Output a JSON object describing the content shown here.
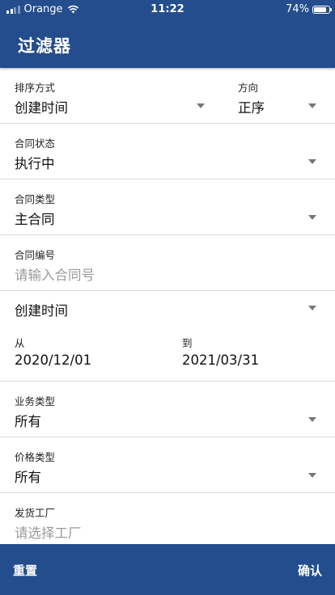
{
  "status_bar": {
    "carrier": "Orange",
    "time": "11:22",
    "battery": "74%"
  },
  "header": {
    "title": "过滤器"
  },
  "sort": {
    "label": "排序方式",
    "value": "创建时间",
    "direction_label": "方向",
    "direction_value": "正序"
  },
  "contract_status": {
    "label": "合同状态",
    "value": "执行中"
  },
  "contract_type": {
    "label": "合同类型",
    "value": "主合同"
  },
  "contract_number": {
    "label": "合同编号",
    "placeholder": "请输入合同号"
  },
  "date_field": {
    "value": "创建时间"
  },
  "date_range": {
    "from_label": "从",
    "from_value": "2020/12/01",
    "to_label": "到",
    "to_value": "2021/03/31"
  },
  "business_type": {
    "label": "业务类型",
    "value": "所有"
  },
  "price_type": {
    "label": "价格类型",
    "value": "所有"
  },
  "factory": {
    "label": "发货工厂",
    "placeholder": "请选择工厂"
  },
  "footer": {
    "reset_label": "重置",
    "confirm_label": "确认"
  }
}
